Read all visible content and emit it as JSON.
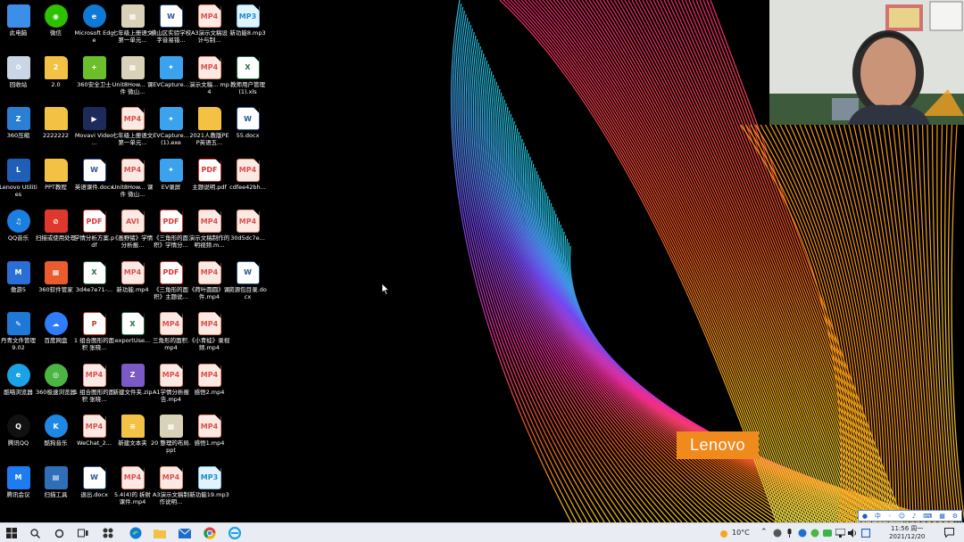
{
  "desktop_icons": [
    {
      "label": "此电脑",
      "kind": "pc"
    },
    {
      "label": "微信",
      "kind": "wechat"
    },
    {
      "label": "Microsoft Edge",
      "kind": "edge"
    },
    {
      "label": "七年级上册语文第一单元...",
      "kind": "img"
    },
    {
      "label": "横山区实验学校字音易错...",
      "kind": "doc"
    },
    {
      "label": "A3演示文稿设计与制...",
      "kind": "mp4"
    },
    {
      "label": "新功能8.mp3",
      "kind": "mp3"
    },
    {
      "label": "回收站",
      "kind": "recycle"
    },
    {
      "label": "2.0",
      "kind": "folder-red"
    },
    {
      "label": "360安全卫士",
      "kind": "s360"
    },
    {
      "label": "Unit8How... 课件 微山...",
      "kind": "img"
    },
    {
      "label": "EVCapture...",
      "kind": "ev"
    },
    {
      "label": "演示文稿... mp4",
      "kind": "mp4"
    },
    {
      "label": "教师用户管理(1).xls",
      "kind": "xls"
    },
    {
      "label": "360压缩",
      "kind": "zip360"
    },
    {
      "label": "2222222",
      "kind": "folder"
    },
    {
      "label": "Movavi Video ...",
      "kind": "movavi"
    },
    {
      "label": "七年级上册语文第一单元...",
      "kind": "mp4"
    },
    {
      "label": "EVCapture... (1).exe",
      "kind": "ev"
    },
    {
      "label": "2021人教版PEP英语五...",
      "kind": "folder"
    },
    {
      "label": "55.docx",
      "kind": "doc"
    },
    {
      "label": "Lenovo Utilities",
      "kind": "lenovo"
    },
    {
      "label": "PPT教程",
      "kind": "folder"
    },
    {
      "label": "英语课件.docx",
      "kind": "doc"
    },
    {
      "label": "Unit8How... 课件 微山...",
      "kind": "mp4"
    },
    {
      "label": "EV录屏",
      "kind": "ev"
    },
    {
      "label": "主题说明.pdf",
      "kind": "pdf"
    },
    {
      "label": "cdfee42bh...",
      "kind": "mp4"
    },
    {
      "label": "QQ音乐",
      "kind": "qqmusic"
    },
    {
      "label": "扫描或使用处理",
      "kind": "ban"
    },
    {
      "label": "学情分析方案.pdf",
      "kind": "pdf"
    },
    {
      "label": "《画野猪》学情分析报...",
      "kind": "avi"
    },
    {
      "label": "《三角形的面积》学情分...",
      "kind": "pdf"
    },
    {
      "label": "演示文稿制作的明视频.m...",
      "kind": "mp4"
    },
    {
      "label": "30d5dc7e...",
      "kind": "mp4"
    },
    {
      "label": "傲游5",
      "kind": "maxthon"
    },
    {
      "label": "360软件管家",
      "kind": "s360mgr"
    },
    {
      "label": "3d4e7e71-...",
      "kind": "xls"
    },
    {
      "label": "新功能.mp4",
      "kind": "mp4"
    },
    {
      "label": "《三角形的面积》主题说...",
      "kind": "pdf"
    },
    {
      "label": "《荷叶圆圆》课件.mp4",
      "kind": "mp4"
    },
    {
      "label": "资源包目录.docx",
      "kind": "doc"
    },
    {
      "label": "丹青文件管理 9.02",
      "kind": "danqing"
    },
    {
      "label": "百度网盘",
      "kind": "baidu"
    },
    {
      "label": "1 组合图形的面积 张晓...",
      "kind": "ppt"
    },
    {
      "label": "exportUse...",
      "kind": "xls"
    },
    {
      "label": "三角形的面积.mp4",
      "kind": "mp4"
    },
    {
      "label": "《小青蛙》录视频.mp4",
      "kind": "mp4"
    },
    {
      "label": "酷喵浏览器",
      "kind": "ie"
    },
    {
      "label": "360极速浏览器",
      "kind": "chrome360"
    },
    {
      "label": "1 组合图形的面积 张晓...",
      "kind": "mp4"
    },
    {
      "label": "新建文件夹.zip",
      "kind": "zip"
    },
    {
      "label": "A1学情分析报告.mp4",
      "kind": "mp4"
    },
    {
      "label": "感悟2.mp4",
      "kind": "mp4"
    },
    {
      "label": "腾讯QQ",
      "kind": "qq"
    },
    {
      "label": "酷狗音乐",
      "kind": "kugou"
    },
    {
      "label": "WeChat_2...",
      "kind": "mp4"
    },
    {
      "label": "新建文本夹",
      "kind": "folder-doc"
    },
    {
      "label": "20 整理的布局.ppt",
      "kind": "img"
    },
    {
      "label": "感悟1.mp4",
      "kind": "mp4"
    },
    {
      "label": "腾讯会议",
      "kind": "meeting"
    },
    {
      "label": "扫描工具",
      "kind": "scanner"
    },
    {
      "label": "退出.docx",
      "kind": "doc"
    },
    {
      "label": "5.4(4)的 拆射课件.mp4",
      "kind": "mp4"
    },
    {
      "label": "A3演示文稿制作说明...",
      "kind": "mp4"
    },
    {
      "label": "新功能19.mp3",
      "kind": "mp3"
    }
  ],
  "ico_text": {
    "mp4": "MP4",
    "mp3": "MP3",
    "pdf": "PDF",
    "doc": "W",
    "xls": "X",
    "ppt": "P",
    "avi": "AVI"
  },
  "wallpaper": {
    "brand": "Lenovo",
    "brand_color": "#f08a1c"
  },
  "taskbar": {
    "weather": "10°C",
    "time": "11:56 周一",
    "date": "2021/12/20",
    "ime_mode": "中"
  },
  "colors": {
    "taskbar_bg": "#e9ecf2",
    "accent": "#1d5fc2"
  }
}
